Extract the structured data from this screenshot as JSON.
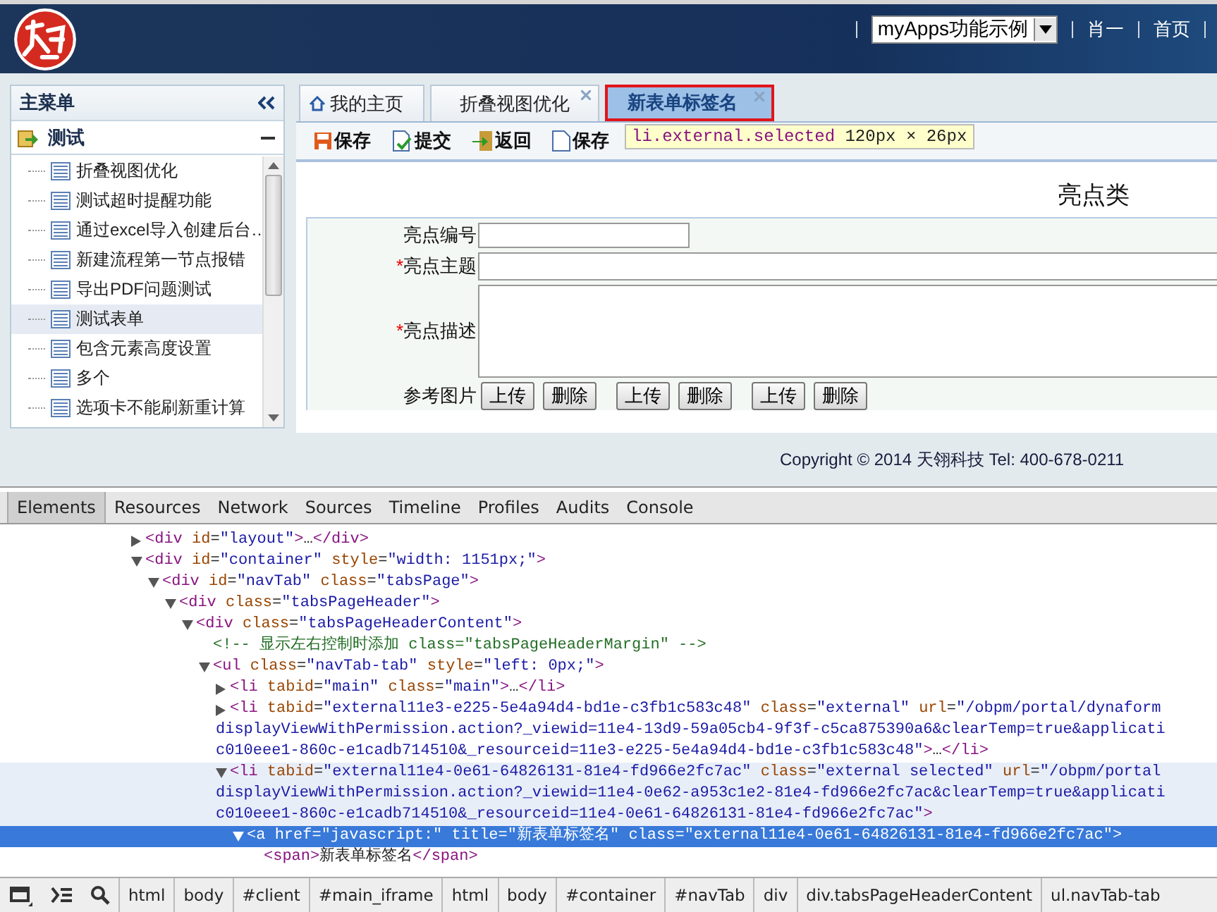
{
  "header": {
    "app_select": "myApps功能示例",
    "user": "肖一",
    "home_link": "首页"
  },
  "sidebar": {
    "title": "主菜单",
    "group": {
      "title": "测试",
      "expanded": true,
      "items": [
        {
          "label": "折叠视图优化",
          "selected": false
        },
        {
          "label": "测试超时提醒功能",
          "selected": false
        },
        {
          "label": "通过excel导入创建后台…",
          "selected": false
        },
        {
          "label": "新建流程第一节点报错",
          "selected": false
        },
        {
          "label": "导出PDF问题测试",
          "selected": false
        },
        {
          "label": "测试表单",
          "selected": true
        },
        {
          "label": "包含元素高度设置",
          "selected": false
        },
        {
          "label": "多个",
          "selected": false
        },
        {
          "label": "选项卡不能刷新重计算",
          "selected": false
        }
      ]
    }
  },
  "tabs": [
    {
      "label": "我的主页",
      "kind": "home",
      "selected": false
    },
    {
      "label": "折叠视图优化",
      "kind": "closable",
      "selected": false
    },
    {
      "label": "新表单标签名",
      "kind": "closable",
      "selected": true
    }
  ],
  "toolbar": [
    {
      "label": "保存",
      "kind": "save"
    },
    {
      "label": "提交",
      "kind": "submit"
    },
    {
      "label": "返回",
      "kind": "back"
    },
    {
      "label": "保存",
      "kind": "doc"
    }
  ],
  "inspect_tooltip": {
    "selector": "li.external.selected",
    "size": "120px × 26px"
  },
  "form": {
    "title": "亮点类",
    "fields": [
      {
        "label": "亮点编号",
        "kind": "text"
      },
      {
        "label": "亮点主题",
        "kind": "wide",
        "required_mark": "*"
      },
      {
        "label": "亮点描述",
        "kind": "textarea",
        "required_mark": "*"
      },
      {
        "label": "参考图片",
        "kind": "upload",
        "buttons": [
          [
            "上传",
            "删除"
          ],
          [
            "上传",
            "删除"
          ],
          [
            "上传",
            "删除"
          ]
        ]
      }
    ]
  },
  "footer": "Copyright © 2014 天翎科技 Tel: 400-678-0211",
  "devtools": {
    "tabs": [
      {
        "label": "Elements",
        "selected": true
      },
      {
        "label": "Resources",
        "selected": false
      },
      {
        "label": "Network",
        "selected": false
      },
      {
        "label": "Sources",
        "selected": false
      },
      {
        "label": "Timeline",
        "selected": false
      },
      {
        "label": "Profiles",
        "selected": false
      },
      {
        "label": "Audits",
        "selected": false
      },
      {
        "label": "Console",
        "selected": false
      }
    ],
    "dom_tree": [
      {
        "kind": "element",
        "expanded": false,
        "selected": false,
        "hovered": false,
        "lines": [
          "<div id=\"layout\">…</div>"
        ]
      },
      {
        "kind": "element",
        "expanded": true,
        "selected": false,
        "hovered": false,
        "lines": [
          "<div id=\"container\" style=\"width: 1151px;\">"
        ],
        "children": [
          {
            "kind": "element",
            "expanded": true,
            "selected": false,
            "hovered": false,
            "lines": [
              "<div id=\"navTab\" class=\"tabsPage\">"
            ],
            "children": [
              {
                "kind": "element",
                "expanded": true,
                "selected": false,
                "hovered": false,
                "lines": [
                  "<div class=\"tabsPageHeader\">"
                ],
                "children": [
                  {
                    "kind": "element",
                    "expanded": true,
                    "selected": false,
                    "hovered": false,
                    "lines": [
                      "<div class=\"tabsPageHeaderContent\">"
                    ],
                    "children": [
                      {
                        "kind": "comment",
                        "selected": false,
                        "hovered": false,
                        "lines": [
                          "<!-- 显示左右控制时添加 class=\"tabsPageHeaderMargin\" -->"
                        ]
                      },
                      {
                        "kind": "element",
                        "expanded": true,
                        "selected": false,
                        "hovered": false,
                        "lines": [
                          "<ul class=\"navTab-tab\" style=\"left: 0px;\">"
                        ],
                        "children": [
                          {
                            "kind": "element",
                            "expanded": false,
                            "selected": false,
                            "hovered": false,
                            "lines": [
                              "<li tabid=\"main\" class=\"main\">…</li>"
                            ]
                          },
                          {
                            "kind": "element",
                            "expanded": false,
                            "selected": false,
                            "hovered": false,
                            "lines": [
                              "<li tabid=\"external11e3-e225-5e4a94d4-bd1e-c3fb1c583c48\" class=\"external\" url=\"/obpm/portal/dynaform",
                              "displayViewWithPermission.action?_viewid=11e4-13d9-59a05cb4-9f3f-c5ca875390a6&clearTemp=true&applicati",
                              "c010eee1-860c-e1cadb714510&_resourceid=11e3-e225-5e4a94d4-bd1e-c3fb1c583c48\">…</li>"
                            ]
                          },
                          {
                            "kind": "element",
                            "expanded": true,
                            "selected": false,
                            "hovered": true,
                            "lines": [
                              "<li tabid=\"external11e4-0e61-64826131-81e4-fd966e2fc7ac\" class=\"external selected\" url=\"/obpm/portal",
                              "displayViewWithPermission.action?_viewid=11e4-0e62-a953c1e2-81e4-fd966e2fc7ac&clearTemp=true&applicati",
                              "c010eee1-860c-e1cadb714510&_resourceid=11e4-0e61-64826131-81e4-fd966e2fc7ac\">"
                            ],
                            "children": [
                              {
                                "kind": "element",
                                "expanded": true,
                                "selected": true,
                                "hovered": false,
                                "lines": [
                                  "<a href=\"javascript:\" title=\"新表单标签名\" class=\"external11e4-0e61-64826131-81e4-fd966e2fc7ac\">"
                                ],
                                "children": [
                                  {
                                    "kind": "leaf",
                                    "selected": false,
                                    "hovered": false,
                                    "lines": [
                                      "<span>新表单标签名</span>"
                                    ]
                                  }
                                ]
                              }
                            ]
                          }
                        ]
                      }
                    ]
                  }
                ]
              }
            ]
          }
        ]
      }
    ],
    "breadcrumbs": [
      "html",
      "body",
      "#client",
      "#main_iframe",
      "html",
      "body",
      "#container",
      "#navTab",
      "div",
      "div.tabsPageHeaderContent",
      "ul.navTab-tab"
    ]
  }
}
